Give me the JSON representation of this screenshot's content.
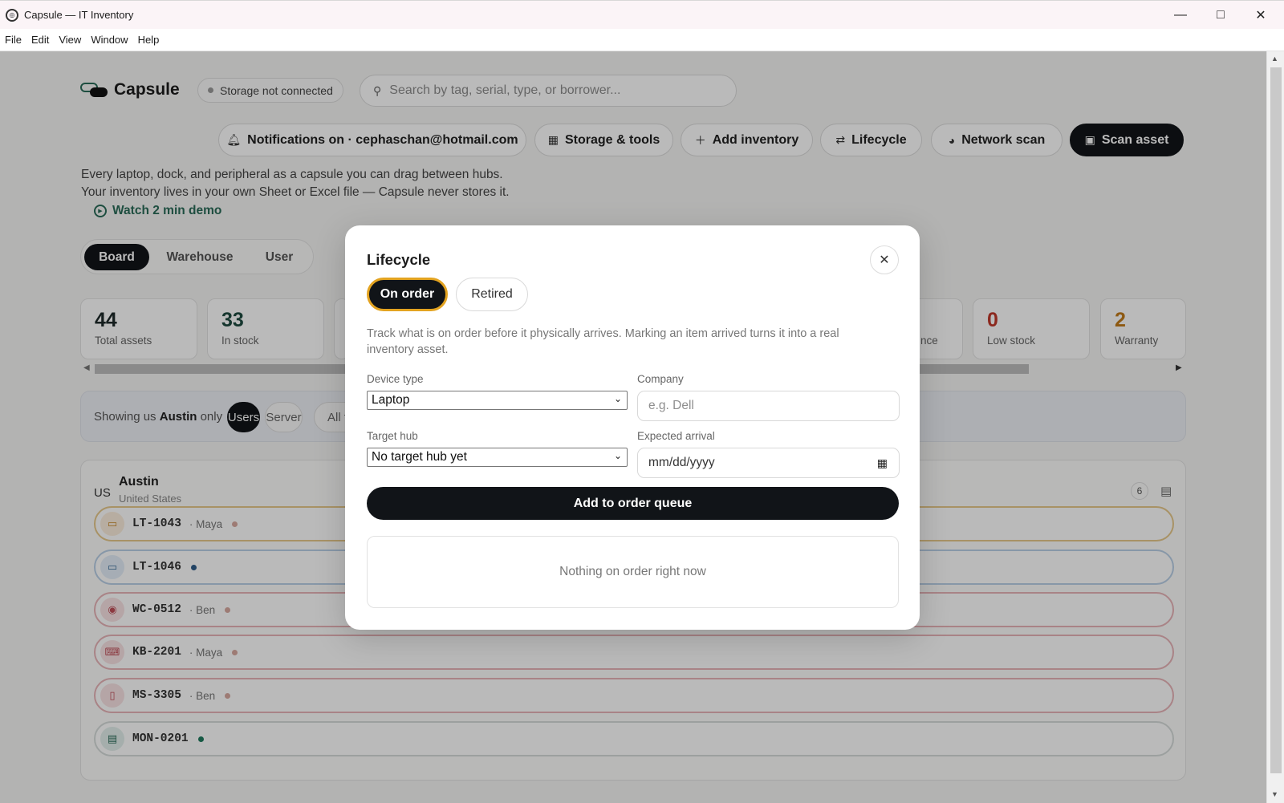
{
  "window": {
    "title": "Capsule — IT Inventory",
    "icon": "app-logo-icon"
  },
  "menu": [
    "File",
    "Edit",
    "View",
    "Window",
    "Help"
  ],
  "header": {
    "brand": "Capsule",
    "storage_status": "Storage not connected",
    "search_placeholder": "Search by tag, serial, type, or borrower..."
  },
  "toolbar": {
    "notifications": "Notifications on · cephaschan@hotmail.com",
    "storage_tools": "Storage & tools",
    "add_inventory": "Add inventory",
    "lifecycle": "Lifecycle",
    "network_scan": "Network scan",
    "scan_asset": "Scan asset"
  },
  "intro": {
    "line1": "Every laptop, dock, and peripheral as a capsule you can drag between hubs.",
    "line2": "Your inventory lives in your own Sheet or Excel file — Capsule never stores it.",
    "demo": "Watch 2 min demo"
  },
  "views": {
    "board": "Board",
    "warehouse": "Warehouse",
    "user": "User",
    "active": "Board"
  },
  "stats": [
    {
      "value": "44",
      "label": "Total assets",
      "color": "#1e2a2a"
    },
    {
      "value": "33",
      "label": "In stock",
      "color": "#1e4a40"
    },
    {
      "value": "",
      "label": "nce",
      "color": "#1e2a2a"
    },
    {
      "value": "0",
      "label": "Low stock",
      "color": "#c0392b"
    },
    {
      "value": "2",
      "label": "Warranty",
      "color": "#c27a1a"
    }
  ],
  "filter": {
    "prefix": "Showing us",
    "hub": "Austin",
    "suffix": "only",
    "chips": [
      "Users",
      "Server",
      "All t"
    ]
  },
  "hub": {
    "code": "US",
    "name": "Austin",
    "country": "United States",
    "count": "6",
    "assets": [
      {
        "tag": "LT-1043",
        "user": "· Maya",
        "icon": "laptop-icon",
        "border": "#e7c98b",
        "icon_bg": "#fbeedd",
        "icon_color": "#c98a2a",
        "dot": "#d7a9a0"
      },
      {
        "tag": "LT-1046",
        "user": "",
        "icon": "laptop-icon",
        "border": "#b9cfe6",
        "icon_bg": "#e4eef8",
        "icon_color": "#3b6e9a",
        "dot": "#2f5d8a"
      },
      {
        "tag": "WC-0512",
        "user": "· Ben",
        "icon": "webcam-icon",
        "border": "#e8b4b8",
        "icon_bg": "#f8e2e4",
        "icon_color": "#c0505a",
        "dot": "#d7a9a0"
      },
      {
        "tag": "KB-2201",
        "user": "· Maya",
        "icon": "keyboard-icon",
        "border": "#e8b4b8",
        "icon_bg": "#f8e2e4",
        "icon_color": "#c0505a",
        "dot": "#d7a9a0"
      },
      {
        "tag": "MS-3305",
        "user": "· Ben",
        "icon": "mouse-icon",
        "border": "#e8b4b8",
        "icon_bg": "#f8e2e4",
        "icon_color": "#c0505a",
        "dot": "#d7a9a0"
      },
      {
        "tag": "MON-0201",
        "user": "",
        "icon": "monitor-icon",
        "border": "#d6dcda",
        "icon_bg": "#e3efec",
        "icon_color": "#2a6b58",
        "dot": "#1f7a5e"
      }
    ]
  },
  "modal": {
    "title": "Lifecycle",
    "tabs": [
      "On order",
      "Retired"
    ],
    "active_tab": "On order",
    "description": "Track what is on order before it physically arrives. Marking an item arrived turns it into a real inventory asset.",
    "device_type_label": "Device type",
    "device_type_value": "Laptop",
    "company_label": "Company",
    "company_placeholder": "e.g. Dell",
    "target_hub_label": "Target hub",
    "target_hub_value": "No target hub yet",
    "arrival_label": "Expected arrival",
    "arrival_placeholder": "mm/dd/yyyy",
    "submit": "Add to order queue",
    "empty": "Nothing on order right now"
  }
}
